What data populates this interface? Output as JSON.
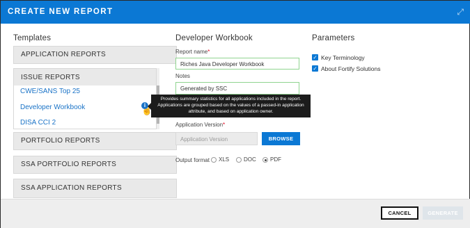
{
  "dialog": {
    "title": "CREATE NEW REPORT",
    "expand_icon": "expand-icon"
  },
  "templates": {
    "heading": "Templates",
    "groups": [
      {
        "label": "APPLICATION REPORTS"
      },
      {
        "label": "ISSUE REPORTS"
      },
      {
        "label": "PORTFOLIO REPORTS"
      },
      {
        "label": "SSA PORTFOLIO REPORTS"
      },
      {
        "label": "SSA APPLICATION REPORTS"
      }
    ],
    "issue_items": [
      "CWE/SANS Top 25",
      "Developer Workbook",
      "DISA CCI 2"
    ],
    "info_icon": "info-icon",
    "tooltip": "Provides summary statistics for all applications included in the report. Applications are grouped based on the values of a passed-in application attribute, and based on application owner."
  },
  "workbook": {
    "heading": "Developer Workbook",
    "report_name_label": "Report name",
    "report_name_value": "Riches Java Developer Workbook",
    "notes_label": "Notes",
    "notes_value": "Generated by SSC",
    "app_version_label": "Application Version",
    "app_version_placeholder": "Application Version",
    "browse_label": "BROWSE",
    "output_format_label": "Output format",
    "formats": [
      "XLS",
      "DOC",
      "PDF"
    ],
    "selected_format": "PDF"
  },
  "parameters": {
    "heading": "Parameters",
    "items": [
      {
        "label": "Key Terminology",
        "checked": true
      },
      {
        "label": "About Fortify Solutions",
        "checked": true
      }
    ]
  },
  "footer": {
    "cancel_label": "CANCEL",
    "generate_label": "GENERATE"
  },
  "colors": {
    "accent": "#0b78d4",
    "link": "#1a73c7",
    "valid_border": "#8fd48f",
    "required": "#e2001a"
  }
}
